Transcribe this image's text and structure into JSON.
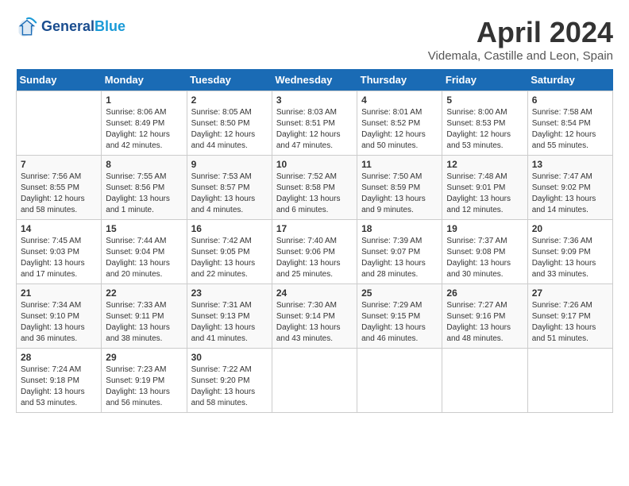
{
  "logo": {
    "line1": "General",
    "line2": "Blue"
  },
  "title": "April 2024",
  "location": "Videmala, Castille and Leon, Spain",
  "days_header": [
    "Sunday",
    "Monday",
    "Tuesday",
    "Wednesday",
    "Thursday",
    "Friday",
    "Saturday"
  ],
  "weeks": [
    [
      {
        "day": "",
        "info": ""
      },
      {
        "day": "1",
        "info": "Sunrise: 8:06 AM\nSunset: 8:49 PM\nDaylight: 12 hours\nand 42 minutes."
      },
      {
        "day": "2",
        "info": "Sunrise: 8:05 AM\nSunset: 8:50 PM\nDaylight: 12 hours\nand 44 minutes."
      },
      {
        "day": "3",
        "info": "Sunrise: 8:03 AM\nSunset: 8:51 PM\nDaylight: 12 hours\nand 47 minutes."
      },
      {
        "day": "4",
        "info": "Sunrise: 8:01 AM\nSunset: 8:52 PM\nDaylight: 12 hours\nand 50 minutes."
      },
      {
        "day": "5",
        "info": "Sunrise: 8:00 AM\nSunset: 8:53 PM\nDaylight: 12 hours\nand 53 minutes."
      },
      {
        "day": "6",
        "info": "Sunrise: 7:58 AM\nSunset: 8:54 PM\nDaylight: 12 hours\nand 55 minutes."
      }
    ],
    [
      {
        "day": "7",
        "info": "Sunrise: 7:56 AM\nSunset: 8:55 PM\nDaylight: 12 hours\nand 58 minutes."
      },
      {
        "day": "8",
        "info": "Sunrise: 7:55 AM\nSunset: 8:56 PM\nDaylight: 13 hours\nand 1 minute."
      },
      {
        "day": "9",
        "info": "Sunrise: 7:53 AM\nSunset: 8:57 PM\nDaylight: 13 hours\nand 4 minutes."
      },
      {
        "day": "10",
        "info": "Sunrise: 7:52 AM\nSunset: 8:58 PM\nDaylight: 13 hours\nand 6 minutes."
      },
      {
        "day": "11",
        "info": "Sunrise: 7:50 AM\nSunset: 8:59 PM\nDaylight: 13 hours\nand 9 minutes."
      },
      {
        "day": "12",
        "info": "Sunrise: 7:48 AM\nSunset: 9:01 PM\nDaylight: 13 hours\nand 12 minutes."
      },
      {
        "day": "13",
        "info": "Sunrise: 7:47 AM\nSunset: 9:02 PM\nDaylight: 13 hours\nand 14 minutes."
      }
    ],
    [
      {
        "day": "14",
        "info": "Sunrise: 7:45 AM\nSunset: 9:03 PM\nDaylight: 13 hours\nand 17 minutes."
      },
      {
        "day": "15",
        "info": "Sunrise: 7:44 AM\nSunset: 9:04 PM\nDaylight: 13 hours\nand 20 minutes."
      },
      {
        "day": "16",
        "info": "Sunrise: 7:42 AM\nSunset: 9:05 PM\nDaylight: 13 hours\nand 22 minutes."
      },
      {
        "day": "17",
        "info": "Sunrise: 7:40 AM\nSunset: 9:06 PM\nDaylight: 13 hours\nand 25 minutes."
      },
      {
        "day": "18",
        "info": "Sunrise: 7:39 AM\nSunset: 9:07 PM\nDaylight: 13 hours\nand 28 minutes."
      },
      {
        "day": "19",
        "info": "Sunrise: 7:37 AM\nSunset: 9:08 PM\nDaylight: 13 hours\nand 30 minutes."
      },
      {
        "day": "20",
        "info": "Sunrise: 7:36 AM\nSunset: 9:09 PM\nDaylight: 13 hours\nand 33 minutes."
      }
    ],
    [
      {
        "day": "21",
        "info": "Sunrise: 7:34 AM\nSunset: 9:10 PM\nDaylight: 13 hours\nand 36 minutes."
      },
      {
        "day": "22",
        "info": "Sunrise: 7:33 AM\nSunset: 9:11 PM\nDaylight: 13 hours\nand 38 minutes."
      },
      {
        "day": "23",
        "info": "Sunrise: 7:31 AM\nSunset: 9:13 PM\nDaylight: 13 hours\nand 41 minutes."
      },
      {
        "day": "24",
        "info": "Sunrise: 7:30 AM\nSunset: 9:14 PM\nDaylight: 13 hours\nand 43 minutes."
      },
      {
        "day": "25",
        "info": "Sunrise: 7:29 AM\nSunset: 9:15 PM\nDaylight: 13 hours\nand 46 minutes."
      },
      {
        "day": "26",
        "info": "Sunrise: 7:27 AM\nSunset: 9:16 PM\nDaylight: 13 hours\nand 48 minutes."
      },
      {
        "day": "27",
        "info": "Sunrise: 7:26 AM\nSunset: 9:17 PM\nDaylight: 13 hours\nand 51 minutes."
      }
    ],
    [
      {
        "day": "28",
        "info": "Sunrise: 7:24 AM\nSunset: 9:18 PM\nDaylight: 13 hours\nand 53 minutes."
      },
      {
        "day": "29",
        "info": "Sunrise: 7:23 AM\nSunset: 9:19 PM\nDaylight: 13 hours\nand 56 minutes."
      },
      {
        "day": "30",
        "info": "Sunrise: 7:22 AM\nSunset: 9:20 PM\nDaylight: 13 hours\nand 58 minutes."
      },
      {
        "day": "",
        "info": ""
      },
      {
        "day": "",
        "info": ""
      },
      {
        "day": "",
        "info": ""
      },
      {
        "day": "",
        "info": ""
      }
    ]
  ]
}
